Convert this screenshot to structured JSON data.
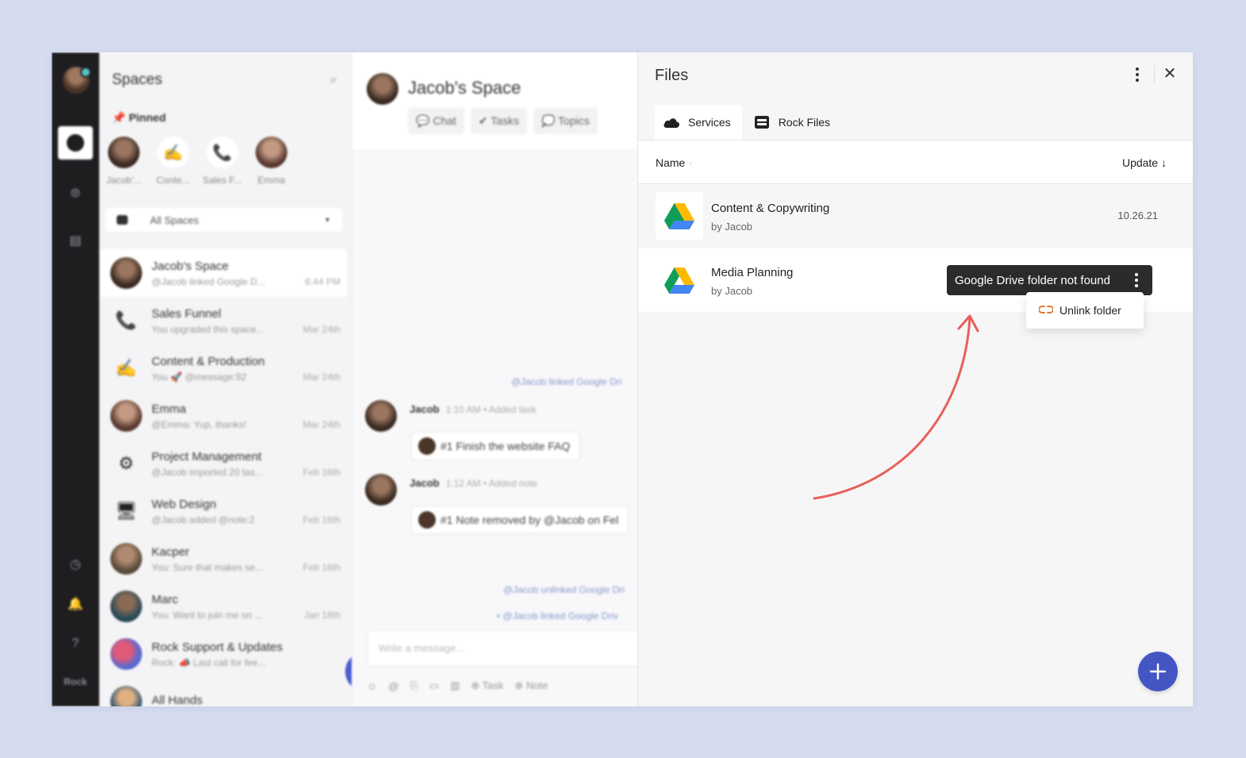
{
  "rail": {
    "label": "Rock"
  },
  "spaces": {
    "title": "Spaces",
    "pinned_label": "Pinned",
    "pinned": [
      {
        "label": "Jacob'..."
      },
      {
        "label": "Conte..."
      },
      {
        "label": "Sales F..."
      },
      {
        "label": "Emma"
      }
    ],
    "filter": "All Spaces",
    "items": [
      {
        "name": "Jacob's Space",
        "sub": "@Jacob linked Google D...",
        "date": "6:44 PM",
        "icon": "avatar"
      },
      {
        "name": "Sales Funnel",
        "sub": "You upgraded this space...",
        "date": "Mar 24th",
        "icon": "phone"
      },
      {
        "name": "Content & Production",
        "sub": "You 🚀 @message:92",
        "date": "Mar 24th",
        "icon": "writing-hand"
      },
      {
        "name": "Emma",
        "sub": "@Emma: Yup, thanks!",
        "date": "Mar 24th",
        "icon": "avatar"
      },
      {
        "name": "Project Management",
        "sub": "@Jacob imported 20 tas...",
        "date": "Feb 16th",
        "icon": "gear"
      },
      {
        "name": "Web Design",
        "sub": "@Jacob added @note:2",
        "date": "Feb 16th",
        "icon": "monitor"
      },
      {
        "name": "Kacper",
        "sub": "You: Sure that makes se...",
        "date": "Feb 16th",
        "icon": "avatar"
      },
      {
        "name": "Marc",
        "sub": "You: Want to join me on ...",
        "date": "Jan 18th",
        "icon": "avatar"
      },
      {
        "name": "Rock Support & Updates",
        "sub": "Rock: 📣 Last call for fee...",
        "date": "",
        "icon": "rock-logo"
      },
      {
        "name": "All Hands",
        "sub": "",
        "date": "",
        "icon": "avatar"
      }
    ]
  },
  "chat": {
    "title": "Jacob's Space",
    "tabs": [
      "Chat",
      "Tasks",
      "Topics"
    ],
    "system1": "@Jacob linked Google Dri",
    "msg1": {
      "author": "Jacob",
      "meta": "1:10 AM • Added task",
      "card": "#1 Finish the website FAQ"
    },
    "msg2": {
      "author": "Jacob",
      "meta": "1:12 AM • Added note",
      "card": "#1 Note removed by @Jacob on Fel"
    },
    "system2": "@Jacob unlinked Google Dri",
    "system3": "• @Jacob linked Google Driv",
    "placeholder": "Write a message...",
    "tools": [
      "Task",
      "Note"
    ]
  },
  "files": {
    "title": "Files",
    "tabs": [
      {
        "label": "Services",
        "icon": "cloud-icon",
        "active": true
      },
      {
        "label": "Rock Files",
        "icon": "rock-files-icon",
        "active": false
      }
    ],
    "columns": {
      "name": "Name",
      "update": "Update"
    },
    "rows": [
      {
        "name": "Content & Copywriting",
        "by": "by Jacob",
        "date": "10.26.21"
      },
      {
        "name": "Media Planning",
        "by": "by Jacob",
        "date": ""
      }
    ],
    "tooltip": "Google Drive folder not found",
    "menu_item": "Unlink folder",
    "colors": {
      "accent": "#4356c4",
      "arrow": "#e8605a",
      "unlink": "#e07a35"
    }
  }
}
